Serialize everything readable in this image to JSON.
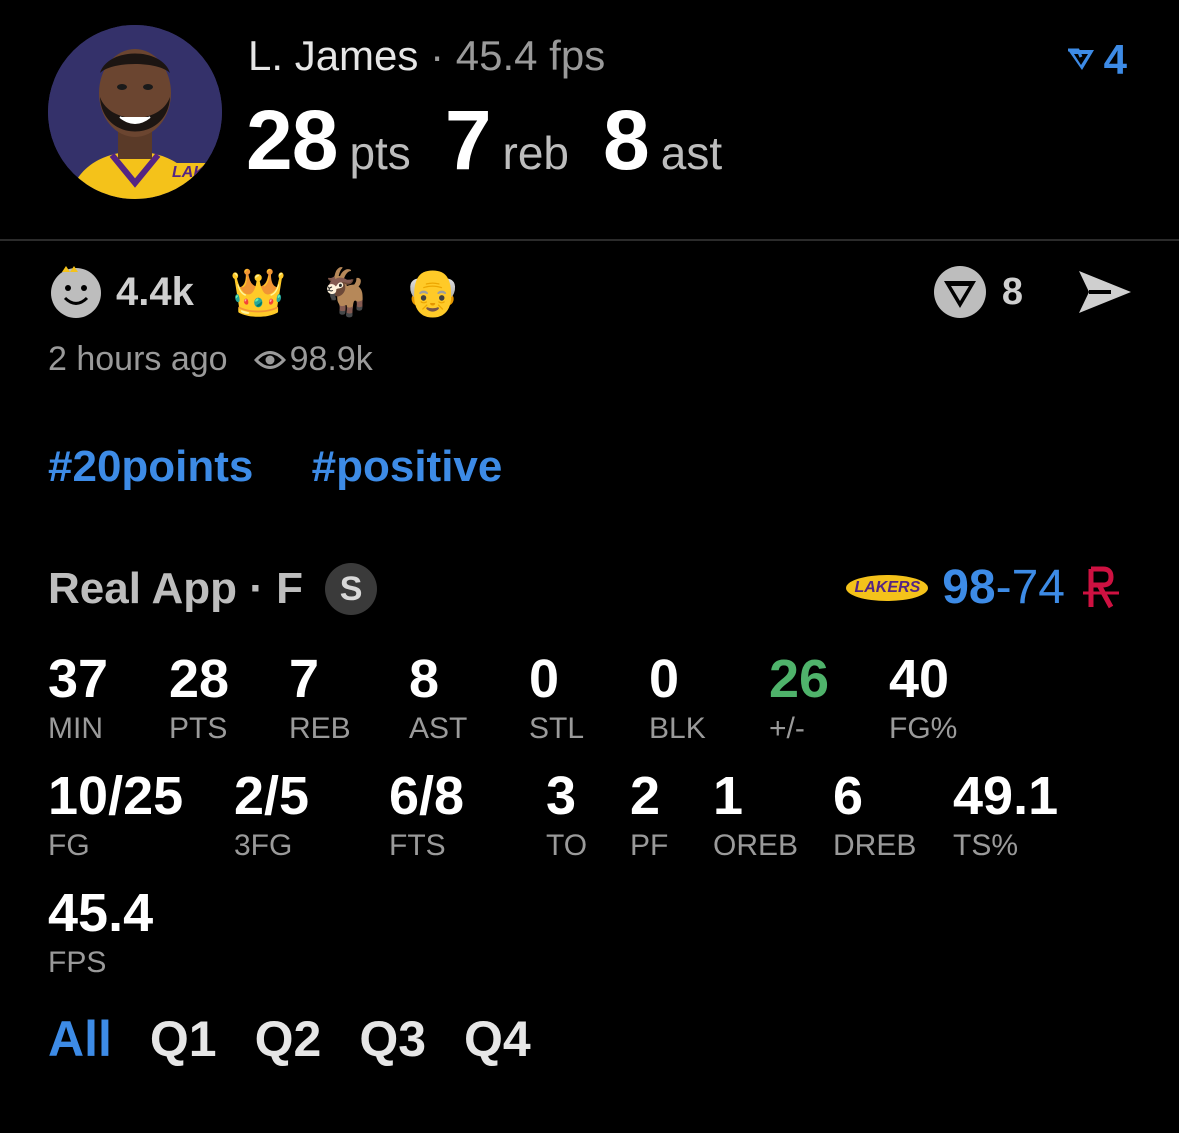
{
  "header": {
    "player_name": "L. James",
    "separator": "·",
    "fps_text": "45.4 fps",
    "stats": [
      {
        "value": "28",
        "unit": "pts"
      },
      {
        "value": "7",
        "unit": "reb"
      },
      {
        "value": "8",
        "unit": "ast"
      }
    ],
    "fav_count": "4",
    "avatar_caption": "LAKERS"
  },
  "reactions": {
    "count": "4.4k",
    "emojis": [
      "👑",
      "🐐",
      "👴"
    ],
    "comment_count": "8"
  },
  "meta": {
    "time_ago": "2 hours ago",
    "views": "98.9k"
  },
  "hashtags": [
    "#20points",
    "#positive"
  ],
  "game": {
    "source": "Real App · F",
    "badge": "S",
    "home_logo_text": "LAKERS",
    "home_score": "98",
    "dash": "-",
    "away_score": "74"
  },
  "stats_rows": [
    [
      {
        "v": "37",
        "l": "MIN"
      },
      {
        "v": "28",
        "l": "PTS"
      },
      {
        "v": "7",
        "l": "REB"
      },
      {
        "v": "8",
        "l": "AST"
      },
      {
        "v": "0",
        "l": "STL"
      },
      {
        "v": "0",
        "l": "BLK"
      },
      {
        "v": "26",
        "l": "+/-"
      },
      {
        "v": "40",
        "l": "FG%"
      }
    ],
    [
      {
        "v": "10/25",
        "l": "FG"
      },
      {
        "v": "2/5",
        "l": "3FG"
      },
      {
        "v": "6/8",
        "l": "FTS"
      },
      {
        "v": "3",
        "l": "TO"
      },
      {
        "v": "2",
        "l": "PF"
      },
      {
        "v": "1",
        "l": "OREB"
      },
      {
        "v": "6",
        "l": "DREB"
      },
      {
        "v": "49.1",
        "l": "TS%"
      }
    ],
    [
      {
        "v": "45.4",
        "l": "FPS"
      }
    ]
  ],
  "quarter_tabs": [
    "All",
    "Q1",
    "Q2",
    "Q3",
    "Q4"
  ],
  "colors": {
    "accent": "#3d8be6",
    "positive": "#4fb36b",
    "background": "#000000"
  }
}
